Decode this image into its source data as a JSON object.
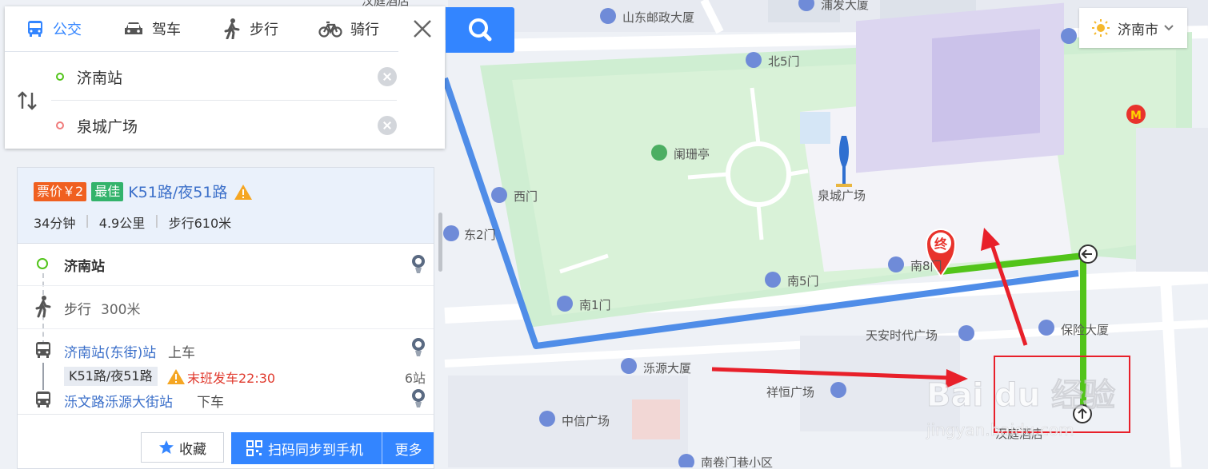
{
  "tabs": [
    {
      "label": "公交",
      "icon": "bus-icon",
      "active": true
    },
    {
      "label": "驾车",
      "icon": "car-icon",
      "active": false
    },
    {
      "label": "步行",
      "icon": "walk-icon",
      "active": false
    },
    {
      "label": "骑行",
      "icon": "bike-icon",
      "active": false
    }
  ],
  "route": {
    "start": "济南站",
    "end": "泉城广场"
  },
  "city": "济南市",
  "plan": {
    "fare_tag": "票价￥2",
    "best_tag": "最佳",
    "line_name": "K51路/夜51路",
    "duration": "34分钟",
    "distance": "4.9公里",
    "walk": "步行610米"
  },
  "steps": {
    "start_name": "济南站",
    "walk1_label": "步行",
    "walk1_dist": "300米",
    "board_station": "济南站(东街)站",
    "board_action": "上车",
    "bus_line": "K51路/夜51路",
    "last_bus": "末班发车22:30",
    "stops": "6站",
    "alight_station": "泺文路泺源大街站",
    "alight_action": "下车"
  },
  "footer": {
    "favorite": "收藏",
    "sync": "扫码同步到手机",
    "more": "更多"
  },
  "map_labels": {
    "top1": "山东邮政大厦",
    "top2": "浦发大厦",
    "top3": "汉庭酒店",
    "north5": "北5门",
    "pavilion": "阑珊亭",
    "west_gate": "西门",
    "east2": "东2门",
    "square": "泉城广场",
    "south8": "南8门",
    "south5": "南5门",
    "south1": "南1门",
    "tianan": "天安时代广场",
    "baoxian": "保险大厦",
    "luoyuan": "泺源大厦",
    "xiangheng": "祥恒广场",
    "zhongxin": "中信广场",
    "hanting_bottom": "汉庭酒店",
    "nanjuan": "南卷门巷小区",
    "end_marker": "终"
  },
  "watermark": {
    "brand": "Bai du 经验",
    "url": "jingyan.baidu.com"
  },
  "colors": {
    "accent": "#3385ff",
    "route_bus": "#4f8de8",
    "route_walk": "#52c41a",
    "fare_tag": "#f06020",
    "best_tag": "#33b36b",
    "warning": "#f5a623",
    "last_bus": "#e03a2e",
    "annotation": "#e8202a"
  }
}
